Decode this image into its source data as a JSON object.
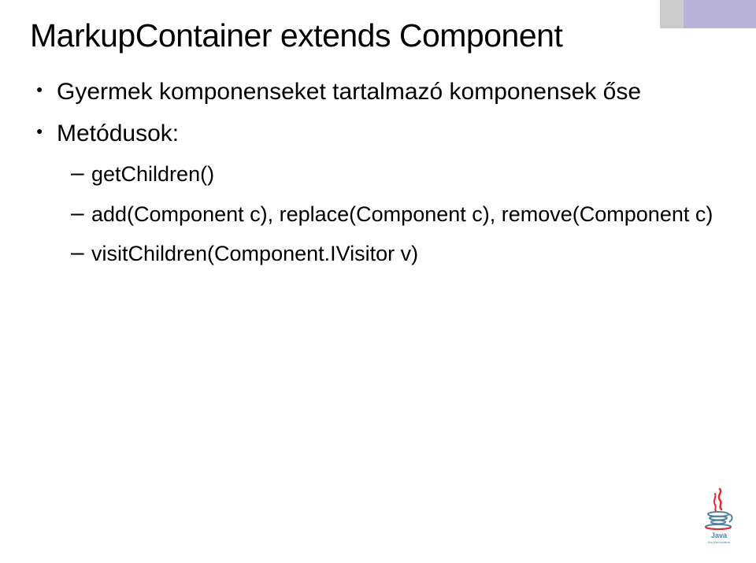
{
  "slide": {
    "title": "MarkupContainer extends Component",
    "bullets": [
      {
        "text": "Gyermek komponenseket tartalmazó komponensek őse"
      },
      {
        "text": "Metódusok:",
        "subitems": [
          "getChildren()",
          "add(Component c), replace(Component c), remove(Component c)",
          "visitChildren(Component.IVisitor v)"
        ]
      }
    ]
  },
  "logo": {
    "name": "Java",
    "tagline": "Sun Microsystems"
  }
}
